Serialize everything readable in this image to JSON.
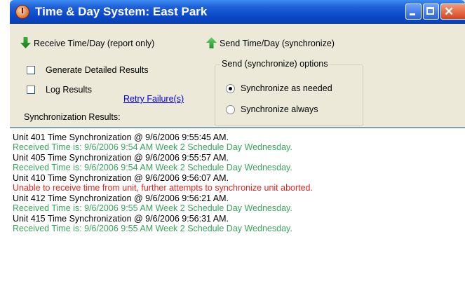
{
  "window": {
    "title": "Time & Day System: East Park"
  },
  "toolbar": {
    "receive_label": "Receive Time/Day  (report only)",
    "send_label": "Send Time/Day (synchronize)"
  },
  "options": {
    "generate_detailed": {
      "label": "Generate Detailed Results",
      "checked": false
    },
    "log_results": {
      "label": "Log Results",
      "checked": false
    },
    "retry_label": "Retry Failure(s)",
    "sync_results_label": "Synchronization Results:"
  },
  "send_options": {
    "title": "Send (synchronize) options",
    "as_needed": {
      "label": "Synchronize as needed",
      "selected": true
    },
    "always": {
      "label": "Synchronize always",
      "selected": false
    }
  },
  "results": [
    {
      "text": "Unit 401 Time Synchronization @ 9/6/2006 9:55:45 AM.",
      "type": "info"
    },
    {
      "text": "Received Time is: 9/6/2006 9:54 AM Week 2 Schedule Day Wednesday.",
      "type": "ok"
    },
    {
      "text": "Unit 405 Time Synchronization @ 9/6/2006 9:55:57 AM.",
      "type": "info"
    },
    {
      "text": "Received Time is: 9/6/2006 9:54 AM Week 2 Schedule Day Wednesday.",
      "type": "ok"
    },
    {
      "text": "Unit 410 Time Synchronization @ 9/6/2006 9:56:07 AM.",
      "type": "info"
    },
    {
      "text": "Unable to receive time from unit, further attempts to synchronize unit aborted.",
      "type": "error"
    },
    {
      "text": "Unit 412 Time Synchronization @ 9/6/2006 9:56:21 AM.",
      "type": "info"
    },
    {
      "text": "Received Time is: 9/6/2006 9:55 AM Week 2 Schedule Day Wednesday.",
      "type": "ok"
    },
    {
      "text": "Unit 415 Time Synchronization @ 9/6/2006 9:56:31 AM.",
      "type": "info"
    },
    {
      "text": "Received Time is: 9/6/2006 9:55 AM Week 2 Schedule Day Wednesday.",
      "type": "ok"
    }
  ],
  "colors": {
    "info": "#000000",
    "ok": "#3aa35a",
    "error": "#e8231c",
    "titlebar": "#0a48c8"
  }
}
